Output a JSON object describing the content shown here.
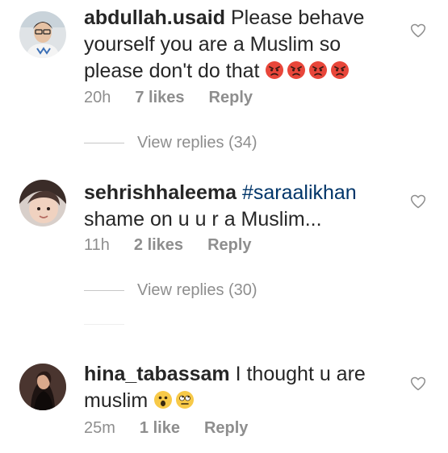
{
  "comments": [
    {
      "username": "abdullah.usaid",
      "text_line1": " Please behave",
      "text_line2": "yourself you are a Muslim so",
      "text_line3": "please don't do that ",
      "emojis": [
        "angry-face",
        "angry-face",
        "angry-face",
        "angry-face"
      ],
      "time": "20h",
      "likes": "7 likes",
      "reply": "Reply",
      "view_replies": "View replies (34)"
    },
    {
      "username": "sehrishhaleema",
      "hashtag": " #saraalikhan",
      "text_line2": "shame on u u r a Muslim...",
      "time": "11h",
      "likes": "2 likes",
      "reply": "Reply",
      "view_replies": "View replies (30)"
    },
    {
      "username": "hina_tabassam",
      "text_line1": " I thought u are",
      "text_line2": "muslim ",
      "emojis": [
        "astonished-face",
        "eye-roll-face"
      ],
      "time": "25m",
      "likes": "1 like",
      "reply": "Reply"
    }
  ],
  "colors": {
    "text": "#262626",
    "meta": "#8e8e8e",
    "hashtag": "#003569",
    "angry_emoji": "#e8463a"
  },
  "icons": {
    "like": "heart-outline-icon"
  }
}
